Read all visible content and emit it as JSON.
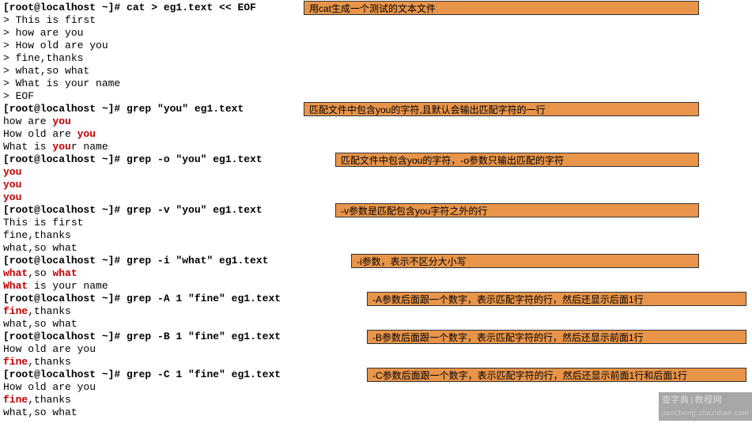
{
  "lines": {
    "l0_prompt": "[root@localhost ~]# cat > eg1.text << EOF",
    "l1": "> This is first",
    "l2": "> how are you",
    "l3": "> How old are you",
    "l4": "> fine,thanks",
    "l5": "> what,so what",
    "l6": "> What is your name",
    "l7": "> EOF",
    "l8_prompt": "[root@localhost ~]# grep \"you\" eg1.text ",
    "l9a": "how are ",
    "l9b": "you",
    "l10a": "How old are ",
    "l10b": "you",
    "l11a": "What is ",
    "l11b": "you",
    "l11c": "r name",
    "l12_prompt": "[root@localhost ~]# grep -o \"you\" eg1.text ",
    "l13": "you",
    "l14": "you",
    "l15": "you",
    "l16_prompt": "[root@localhost ~]# grep -v \"you\" eg1.text ",
    "l17": "This is first",
    "l18": "fine,thanks",
    "l19": "what,so what",
    "l20_prompt": "[root@localhost ~]# grep -i \"what\" eg1.text ",
    "l21a": "what",
    "l21b": ",so ",
    "l21c": "what",
    "l22a": "What",
    "l22b": " is your name",
    "l23_prompt": "[root@localhost ~]# grep -A 1 \"fine\" eg1.text ",
    "l24a": "fine",
    "l24b": ",thanks",
    "l25": "what,so what",
    "l26_prompt": "[root@localhost ~]# grep -B 1 \"fine\" eg1.text ",
    "l27": "How old are you",
    "l28a": "fine",
    "l28b": ",thanks",
    "l29_prompt": "[root@localhost ~]# grep -C 1 \"fine\" eg1.text ",
    "l30": "How old are you",
    "l31a": "fine",
    "l31b": ",thanks",
    "l32": "what,so what"
  },
  "callouts": {
    "c0": "用cat生成一个测试的文本文件",
    "c1": "匹配文件中包含you的字符,且默认会输出匹配字符的一行",
    "c2": "匹配文件中包含you的字符，-o参数只输出匹配的字符",
    "c3": "-v参数是匹配包含you字符之外的行",
    "c4": "-i参数，表示不区分大小写",
    "c5": "-A参数后面跟一个数字，表示匹配字符的行，然后还显示后面1行",
    "c6": "-B参数后面跟一个数字，表示匹配字符的行，然后还显示前面1行",
    "c7": "-C参数后面跟一个数字，表示匹配字符的行，然后还显示前面1行和后面1行"
  },
  "watermark": {
    "main": "查字典",
    "sep": "|",
    "sub": "教程网",
    "url": "jiaocheng.chazidian.com"
  }
}
